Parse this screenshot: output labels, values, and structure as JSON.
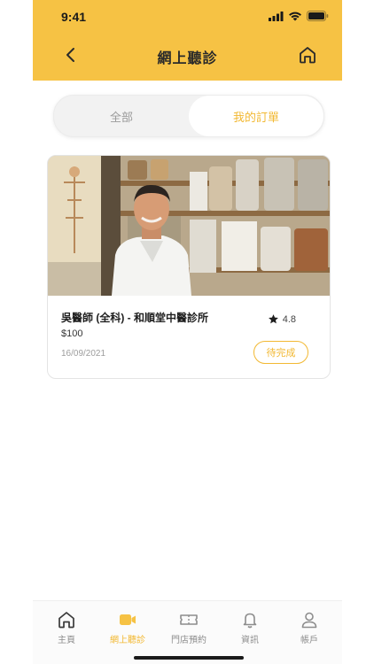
{
  "status_bar": {
    "time": "9:41"
  },
  "header": {
    "title": "網上聽診"
  },
  "segment": {
    "tab_all": "全部",
    "tab_mine": "我的訂單",
    "active": "tab_mine"
  },
  "order_card": {
    "title": "吳醫師 (全科) - 和順堂中醫診所",
    "price": "$100",
    "date": "16/09/2021",
    "rating": "4.8",
    "status": "待完成"
  },
  "tabbar": {
    "items": [
      {
        "label": "主頁",
        "icon": "home-icon"
      },
      {
        "label": "網上聽診",
        "icon": "video-icon"
      },
      {
        "label": "門店預約",
        "icon": "ticket-icon"
      },
      {
        "label": "資訊",
        "icon": "bell-icon"
      },
      {
        "label": "帳戶",
        "icon": "user-icon"
      }
    ],
    "active_index": 1
  },
  "colors": {
    "accent": "#f6c244",
    "accent_text": "#f2b832",
    "muted": "#9a9a9a"
  }
}
